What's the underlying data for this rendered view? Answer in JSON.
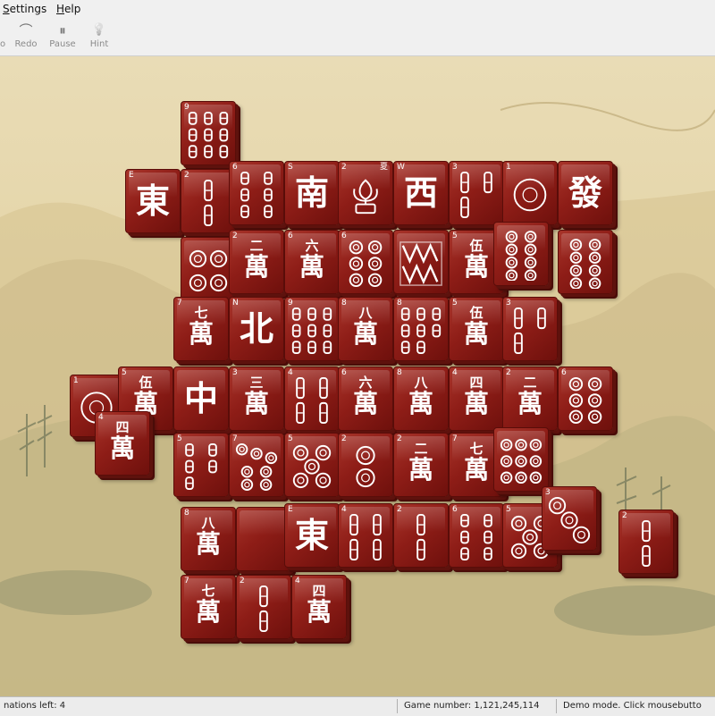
{
  "menubar": {
    "settings": "Settings",
    "settings_ul": "S",
    "settings_rest": "ettings",
    "help_ul": "H",
    "help_rest": "elp"
  },
  "toolbar": [
    {
      "label": "o",
      "icon": "undo-icon",
      "glyph": ""
    },
    {
      "label": "Redo",
      "icon": "redo-icon",
      "glyph": "⌒"
    },
    {
      "label": "Pause",
      "icon": "pause-icon",
      "glyph": "⏸"
    },
    {
      "label": "Hint",
      "icon": "hint-bulb-icon",
      "glyph": "💡"
    }
  ],
  "colors": {
    "tile": "#8e1d17",
    "board": "#e4d4a6"
  },
  "tiles": [
    {
      "id": "bam-9-top",
      "mark": "9",
      "kind": "bam",
      "n": 9
    },
    {
      "id": "east-1",
      "mark": "E",
      "kind": "chr",
      "text": "東"
    },
    {
      "id": "bam-2-a",
      "mark": "2",
      "kind": "bam",
      "n": 2
    },
    {
      "id": "bam-6-a",
      "mark": "6",
      "kind": "bam",
      "n": 6
    },
    {
      "id": "south",
      "mark": "S",
      "kind": "chr",
      "text": "南"
    },
    {
      "id": "summer",
      "mark": "2",
      "mark2": "夏",
      "kind": "flower"
    },
    {
      "id": "west",
      "mark": "W",
      "kind": "chr",
      "text": "西"
    },
    {
      "id": "bam-3-a",
      "mark": "3",
      "kind": "bam",
      "n": 3
    },
    {
      "id": "dot-1-a",
      "mark": "1",
      "kind": "dot",
      "n": 1
    },
    {
      "id": "green-dragon",
      "mark": "",
      "kind": "chr",
      "text": "發"
    },
    {
      "id": "dot-4-a",
      "mark": "",
      "kind": "dot",
      "n": 4
    },
    {
      "id": "char-2-a",
      "mark": "2",
      "kind": "wan",
      "num": "二"
    },
    {
      "id": "char-6-a",
      "mark": "6",
      "kind": "wan",
      "num": "六"
    },
    {
      "id": "dot-6-a",
      "mark": "6",
      "kind": "dot",
      "n": 6
    },
    {
      "id": "white-dragon",
      "mark": "",
      "kind": "wd"
    },
    {
      "id": "char-5-a",
      "mark": "5",
      "kind": "wan",
      "num": "伍"
    },
    {
      "id": "dot-8-a",
      "mark": "",
      "kind": "dot",
      "n": 8
    },
    {
      "id": "dot-8-b",
      "mark": "",
      "kind": "dot",
      "n": 8
    },
    {
      "id": "char-7-a",
      "mark": "7",
      "kind": "wan",
      "num": "七"
    },
    {
      "id": "north",
      "mark": "N",
      "kind": "chr",
      "text": "北"
    },
    {
      "id": "bam-9-b",
      "mark": "9",
      "kind": "bam",
      "n": 9
    },
    {
      "id": "char-8-a",
      "mark": "8",
      "kind": "wan",
      "num": "八"
    },
    {
      "id": "bam-8-a",
      "mark": "8",
      "kind": "bam",
      "n": 8
    },
    {
      "id": "char-5-b",
      "mark": "5",
      "kind": "wan",
      "num": "伍"
    },
    {
      "id": "bam-3-b",
      "mark": "3",
      "kind": "bam",
      "n": 3
    },
    {
      "id": "dot-1-b",
      "mark": "1",
      "kind": "dot",
      "n": 1
    },
    {
      "id": "char-5-c",
      "mark": "5",
      "kind": "wan",
      "num": "伍"
    },
    {
      "id": "red-dragon",
      "mark": "",
      "kind": "chr",
      "text": "中"
    },
    {
      "id": "char-3-a",
      "mark": "3",
      "kind": "wan",
      "num": "三"
    },
    {
      "id": "bam-4-a",
      "mark": "4",
      "kind": "bam",
      "n": 4
    },
    {
      "id": "char-6-b",
      "mark": "6",
      "kind": "wan",
      "num": "六"
    },
    {
      "id": "char-8-b",
      "mark": "8",
      "kind": "wan",
      "num": "八"
    },
    {
      "id": "char-4-a",
      "mark": "4",
      "kind": "wan",
      "num": "四"
    },
    {
      "id": "char-2-b",
      "mark": "2",
      "kind": "wan",
      "num": "二"
    },
    {
      "id": "dot-6-b",
      "mark": "6",
      "kind": "dot",
      "n": 6
    },
    {
      "id": "char-4-b",
      "mark": "4",
      "kind": "wan",
      "num": "四"
    },
    {
      "id": "bam-5-a",
      "mark": "5",
      "kind": "bam",
      "n": 5
    },
    {
      "id": "dot-7-a",
      "mark": "7",
      "kind": "dot",
      "n": 7
    },
    {
      "id": "dot-5-a",
      "mark": "5",
      "kind": "dot",
      "n": 5
    },
    {
      "id": "dot-2-a",
      "mark": "2",
      "kind": "dot",
      "n": 2
    },
    {
      "id": "char-2-c",
      "mark": "2",
      "kind": "wan",
      "num": "二"
    },
    {
      "id": "char-7-b",
      "mark": "7",
      "kind": "wan",
      "num": "七"
    },
    {
      "id": "dot-9-a",
      "mark": "",
      "kind": "dot",
      "n": 9
    },
    {
      "id": "char-8-c",
      "mark": "8",
      "kind": "wan",
      "num": "八"
    },
    {
      "id": "blank",
      "mark": "",
      "kind": "blank"
    },
    {
      "id": "east-2",
      "mark": "E",
      "kind": "chr",
      "text": "東"
    },
    {
      "id": "bam-4-b",
      "mark": "4",
      "kind": "bam",
      "n": 4
    },
    {
      "id": "bam-2-b",
      "mark": "2",
      "kind": "bam",
      "n": 2
    },
    {
      "id": "bam-6-b",
      "mark": "6",
      "kind": "bam",
      "n": 6
    },
    {
      "id": "dot-5-b",
      "mark": "5",
      "kind": "dot",
      "n": 5
    },
    {
      "id": "dot-3-a",
      "mark": "3",
      "kind": "dot",
      "n": 3
    },
    {
      "id": "bam-2-c",
      "mark": "2",
      "kind": "bam",
      "n": 2
    },
    {
      "id": "char-7-c",
      "mark": "7",
      "kind": "wan",
      "num": "七"
    },
    {
      "id": "bam-2-d",
      "mark": "2",
      "kind": "bam",
      "n": 2
    },
    {
      "id": "char-4-c",
      "mark": "4",
      "kind": "wan",
      "num": "四"
    }
  ],
  "status": {
    "combinations": "nations left: 4",
    "game_number": "Game number: 1,121,245,114",
    "mode": "Demo mode. Click mousebutto"
  }
}
